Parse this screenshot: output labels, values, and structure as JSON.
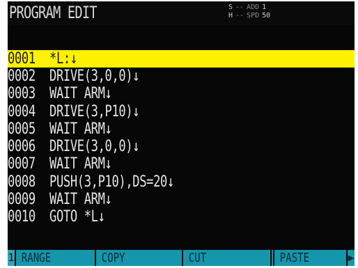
{
  "title": "PROGRAM EDIT",
  "status": {
    "row1": [
      "S",
      "--",
      "ADD",
      "1"
    ],
    "row2": [
      "H",
      "--",
      "SPD",
      "50"
    ]
  },
  "program_lines": [
    {
      "num": "0001",
      "code": "*L:↓",
      "selected": true
    },
    {
      "num": "0002",
      "code": "DRIVE(3,0,0)↓"
    },
    {
      "num": "0003",
      "code": "WAIT ARM↓"
    },
    {
      "num": "0004",
      "code": "DRIVE(3,P10)↓"
    },
    {
      "num": "0005",
      "code": "WAIT ARM↓"
    },
    {
      "num": "0006",
      "code": "DRIVE(3,0,0)↓"
    },
    {
      "num": "0007",
      "code": "WAIT ARM↓"
    },
    {
      "num": "0008",
      "code": "PUSH(3,P10),DS=20↓"
    },
    {
      "num": "0009",
      "code": "WAIT ARM↓"
    },
    {
      "num": "0010",
      "code": "GOTO *L↓"
    }
  ],
  "softkeys": {
    "index": "1",
    "keys": [
      "RANGE",
      "COPY",
      "CUT",
      "",
      "PASTE"
    ],
    "next": "▶"
  },
  "colors": {
    "background": "#070707",
    "highlight": "#fff200",
    "softkey": "#1596ad",
    "text": "#e6e6e6"
  }
}
